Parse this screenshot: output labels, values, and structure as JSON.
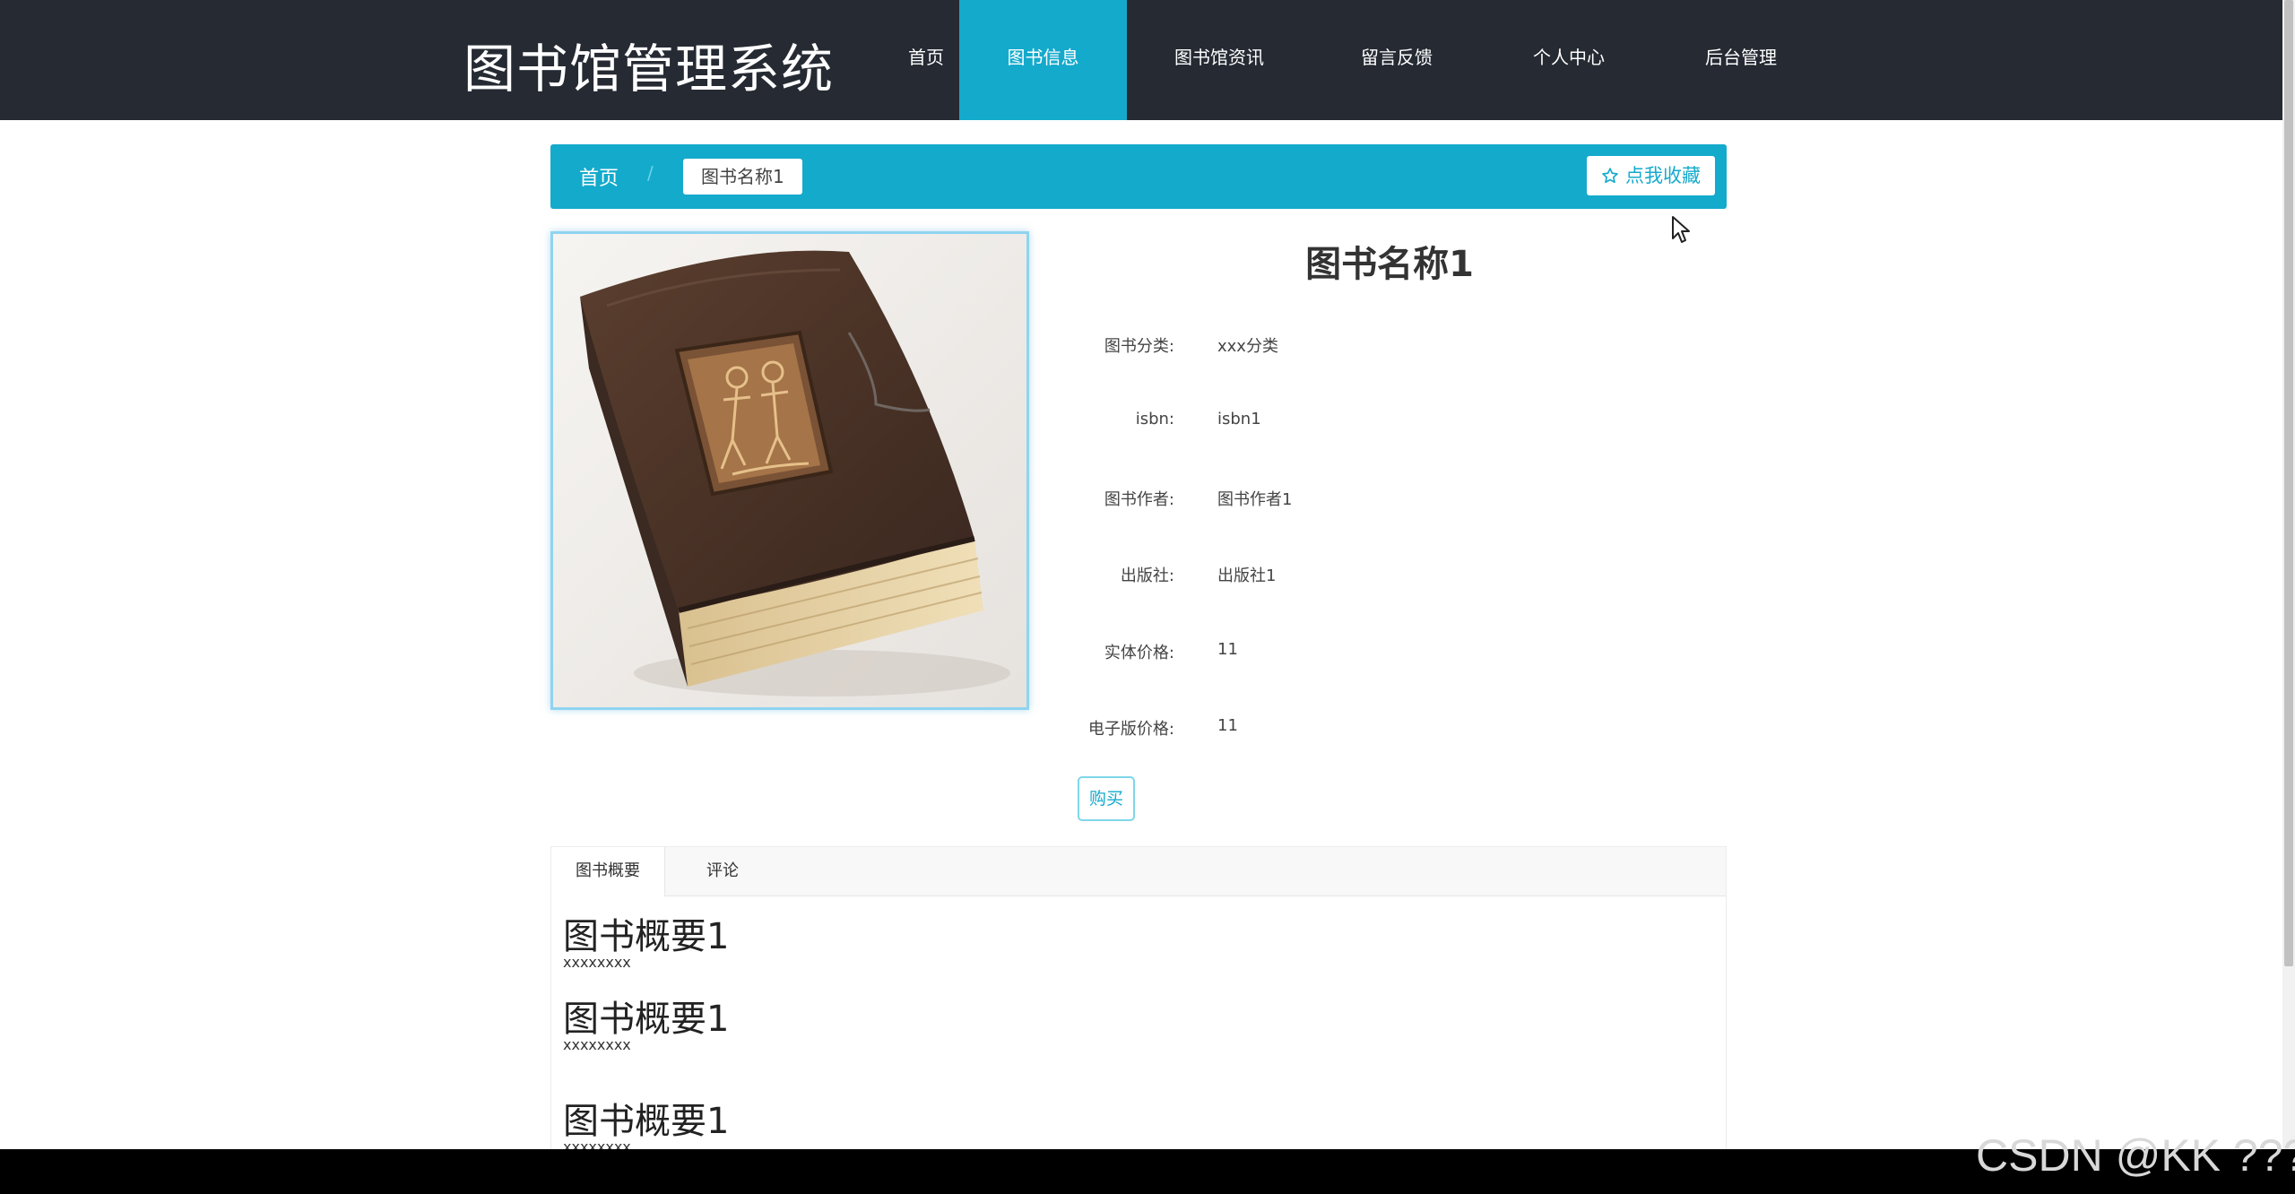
{
  "site": {
    "title": "图书馆管理系统"
  },
  "nav": {
    "items": [
      {
        "label": "首页"
      },
      {
        "label": "图书信息"
      },
      {
        "label": "图书馆资讯"
      },
      {
        "label": "留言反馈"
      },
      {
        "label": "个人中心"
      },
      {
        "label": "后台管理"
      }
    ],
    "active": "图书信息"
  },
  "breadcrumb": {
    "home": "首页",
    "separator": "/",
    "current": "图书名称1",
    "favorite_icon": "star-outline-icon",
    "favorite_label": "点我收藏"
  },
  "book": {
    "image_icon": "book-cover-image",
    "title": "图书名称1",
    "fields": [
      {
        "label": "图书分类:",
        "value": "xxx分类"
      },
      {
        "label": "isbn:",
        "value": "isbn1"
      },
      {
        "label": "图书作者:",
        "value": "图书作者1"
      },
      {
        "label": "出版社:",
        "value": "出版社1"
      },
      {
        "label": "实体价格:",
        "value": "11"
      },
      {
        "label": "电子版价格:",
        "value": "11"
      }
    ],
    "buy_label": "购买"
  },
  "tabs": {
    "items": [
      {
        "label": "图书概要"
      },
      {
        "label": "评论"
      }
    ],
    "active": "图书概要"
  },
  "summary": [
    {
      "heading": "图书概要1",
      "text": "xxxxxxxx"
    },
    {
      "heading": "图书概要1",
      "text": "xxxxxxxx"
    },
    {
      "heading": "图书概要1",
      "text": "xxxxxxxx"
    }
  ],
  "watermark": "CSDN @KK ???",
  "colors": {
    "nav_bg": "#252a33",
    "accent": "#14aacc",
    "bottom_bar": "#000000"
  }
}
